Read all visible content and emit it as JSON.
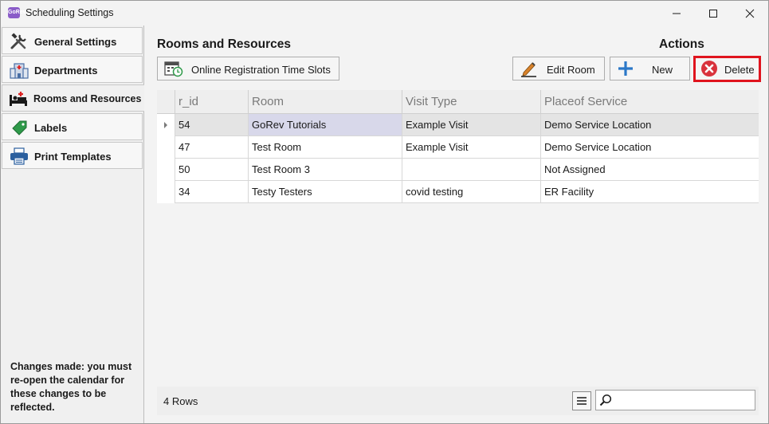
{
  "window": {
    "title": "Scheduling Settings",
    "app_icon_text": "GoRev"
  },
  "sidebar": {
    "items": [
      {
        "label": "General Settings",
        "icon": "tools-icon"
      },
      {
        "label": "Departments",
        "icon": "building-icon"
      },
      {
        "label": "Rooms and Resources",
        "icon": "bed-icon"
      },
      {
        "label": "Labels",
        "icon": "tag-icon"
      },
      {
        "label": "Print Templates",
        "icon": "printer-icon"
      }
    ],
    "active_index": 2,
    "note": "Changes made: you must re-open the calendar for these changes to be reflected."
  },
  "main": {
    "section_title": "Rooms and Resources",
    "actions_title": "Actions",
    "toolbar": {
      "online_slots_label": "Online Registration Time Slots",
      "edit_room_label": "Edit Room",
      "new_label": "New",
      "delete_label": "Delete"
    },
    "grid": {
      "columns": [
        "r_id",
        "Room",
        "Visit Type",
        "Placeof Service"
      ],
      "rows": [
        [
          "54",
          "GoRev Tutorials",
          "Example Visit",
          "Demo Service Location"
        ],
        [
          "47",
          "Test Room",
          "Example Visit",
          "Demo Service Location"
        ],
        [
          "50",
          "Test Room 3",
          "",
          "Not Assigned"
        ],
        [
          "34",
          "Testy Testers",
          "covid testing",
          "ER Facility"
        ]
      ],
      "selected_row": 0
    },
    "footer": {
      "rows_count": "4 Rows",
      "search_value": ""
    }
  },
  "colors": {
    "delete_highlight": "#e0141e",
    "delete_icon": "#d9323c",
    "new_icon": "#2b78c8",
    "selected_cell": "#d8d8ea"
  }
}
